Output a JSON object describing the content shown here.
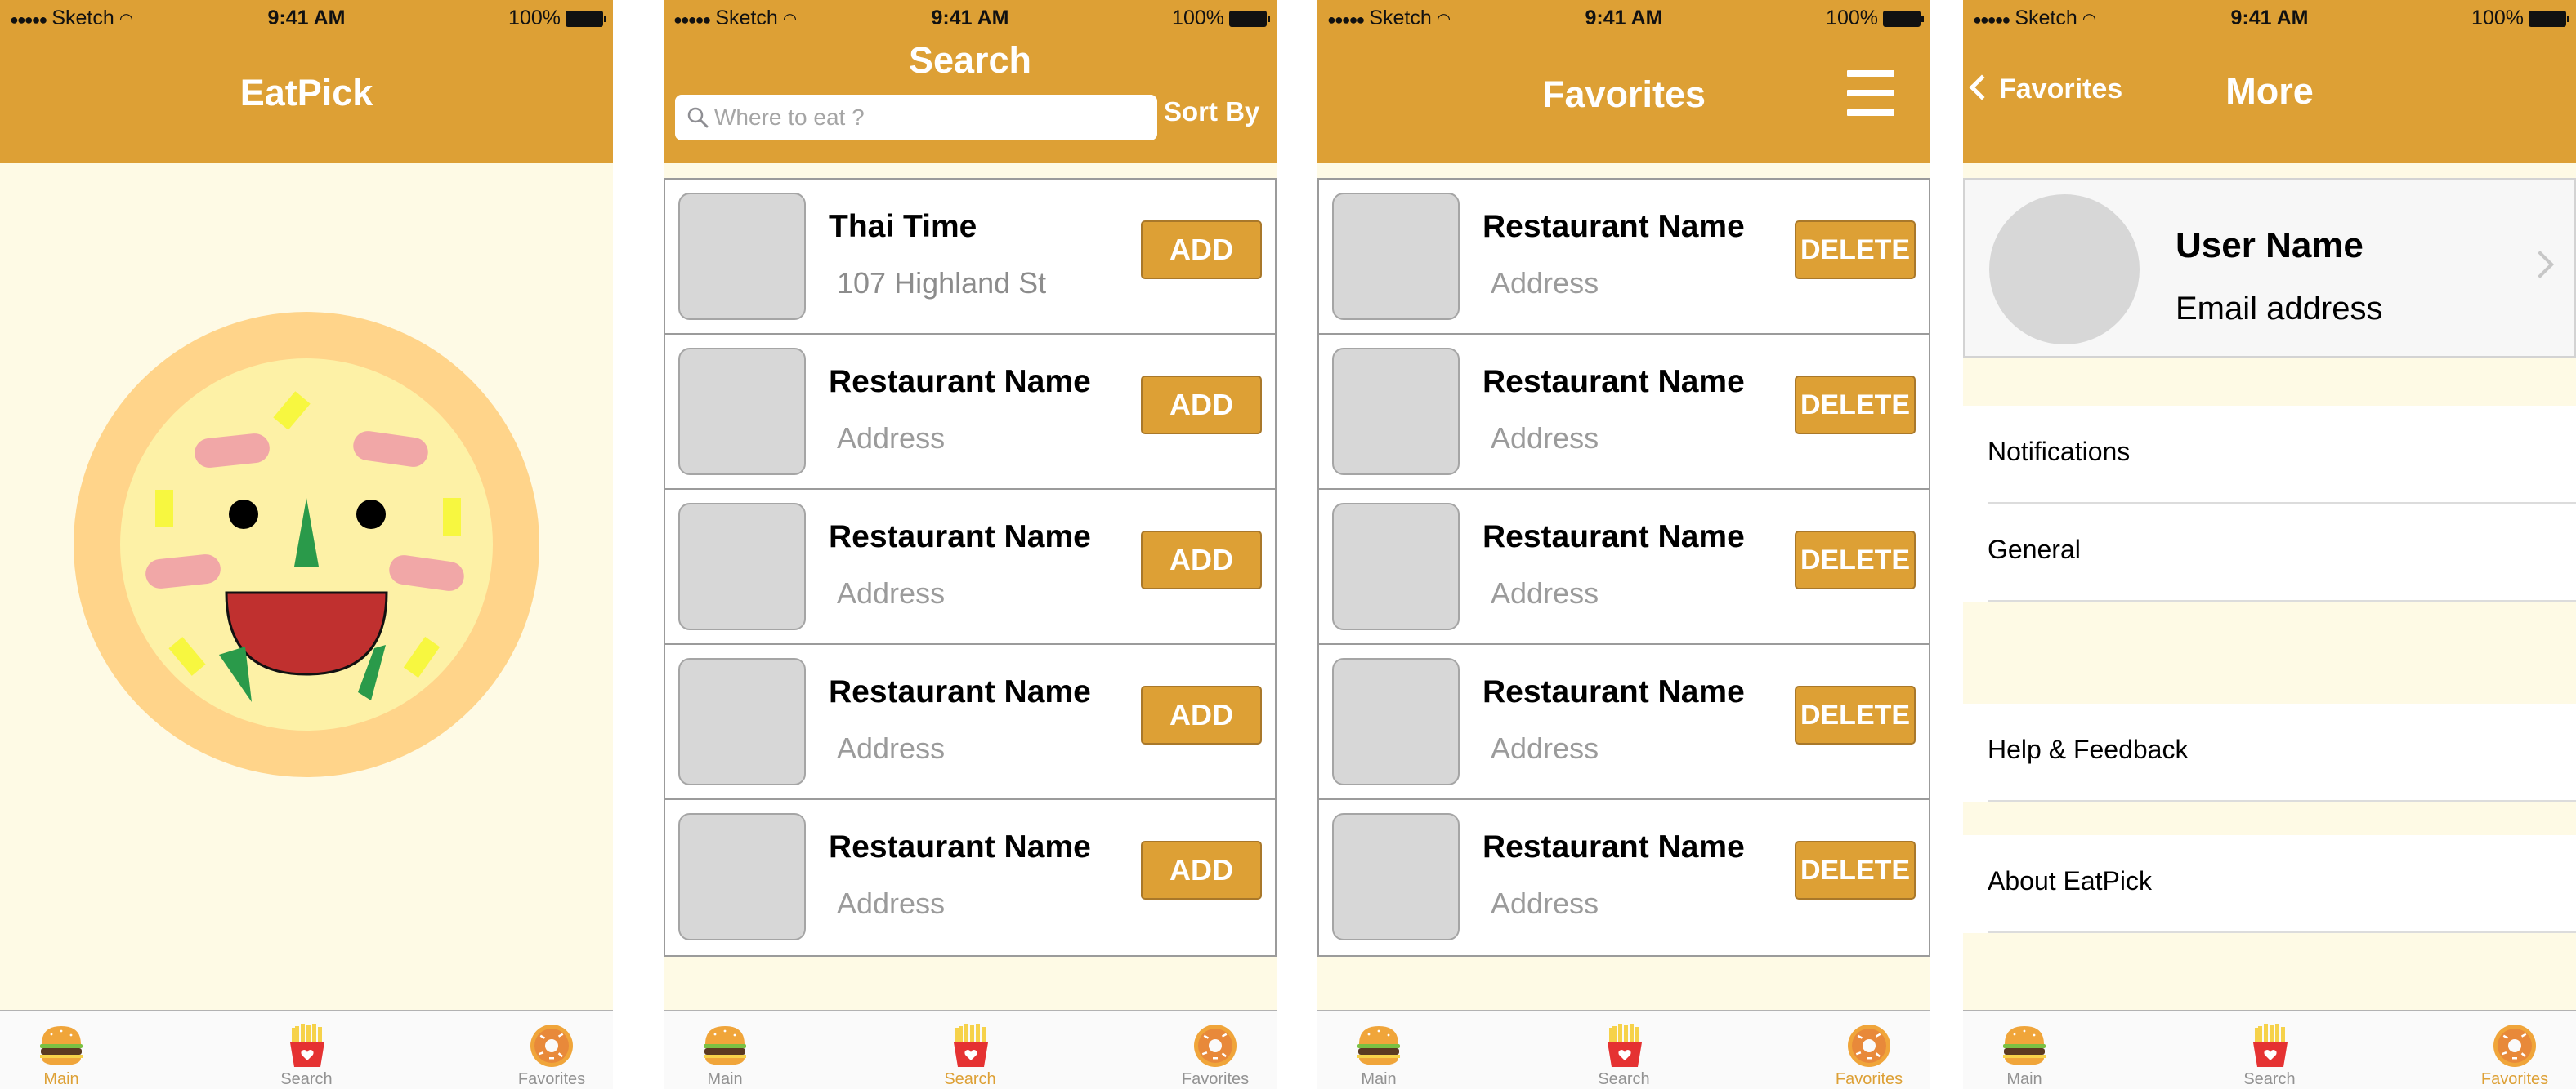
{
  "status_bar": {
    "signal": "●●●●●",
    "carrier": "Sketch",
    "time": "9:41 AM",
    "battery": "100%"
  },
  "tabs": {
    "main": "Main",
    "search": "Search",
    "favorites": "Favorites",
    "main_icon": "burger-icon",
    "search_icon": "fries-icon",
    "favorites_icon": "donut-icon"
  },
  "screen_main": {
    "title": "EatPick"
  },
  "screen_search": {
    "title": "Search",
    "search_placeholder": "Where to eat ?",
    "sort_label": "Sort By",
    "action_label": "ADD",
    "results": [
      {
        "name": "Thai Time",
        "address": "107 Highland St"
      },
      {
        "name": "Restaurant Name",
        "address": "Address"
      },
      {
        "name": "Restaurant Name",
        "address": "Address"
      },
      {
        "name": "Restaurant Name",
        "address": "Address"
      },
      {
        "name": "Restaurant Name",
        "address": "Address"
      }
    ]
  },
  "screen_favorites": {
    "title": "Favorites",
    "action_label": "DELETE",
    "items": [
      {
        "name": "Restaurant Name",
        "address": "Address"
      },
      {
        "name": "Restaurant Name",
        "address": "Address"
      },
      {
        "name": "Restaurant Name",
        "address": "Address"
      },
      {
        "name": "Restaurant Name",
        "address": "Address"
      },
      {
        "name": "Restaurant Name",
        "address": "Address"
      }
    ]
  },
  "screen_more": {
    "title": "More",
    "back_label": "Favorites",
    "user_name": "User Name",
    "email": "Email address",
    "settings": {
      "notifications": "Notifications",
      "general": "General",
      "help": "Help & Feedback",
      "about": "About EatPick"
    }
  },
  "colors": {
    "brand": "#dda035",
    "background": "#fefae5",
    "tab_active": "#dda035",
    "tab_inactive": "#929292",
    "placeholder_gray": "#d7d7d7"
  }
}
